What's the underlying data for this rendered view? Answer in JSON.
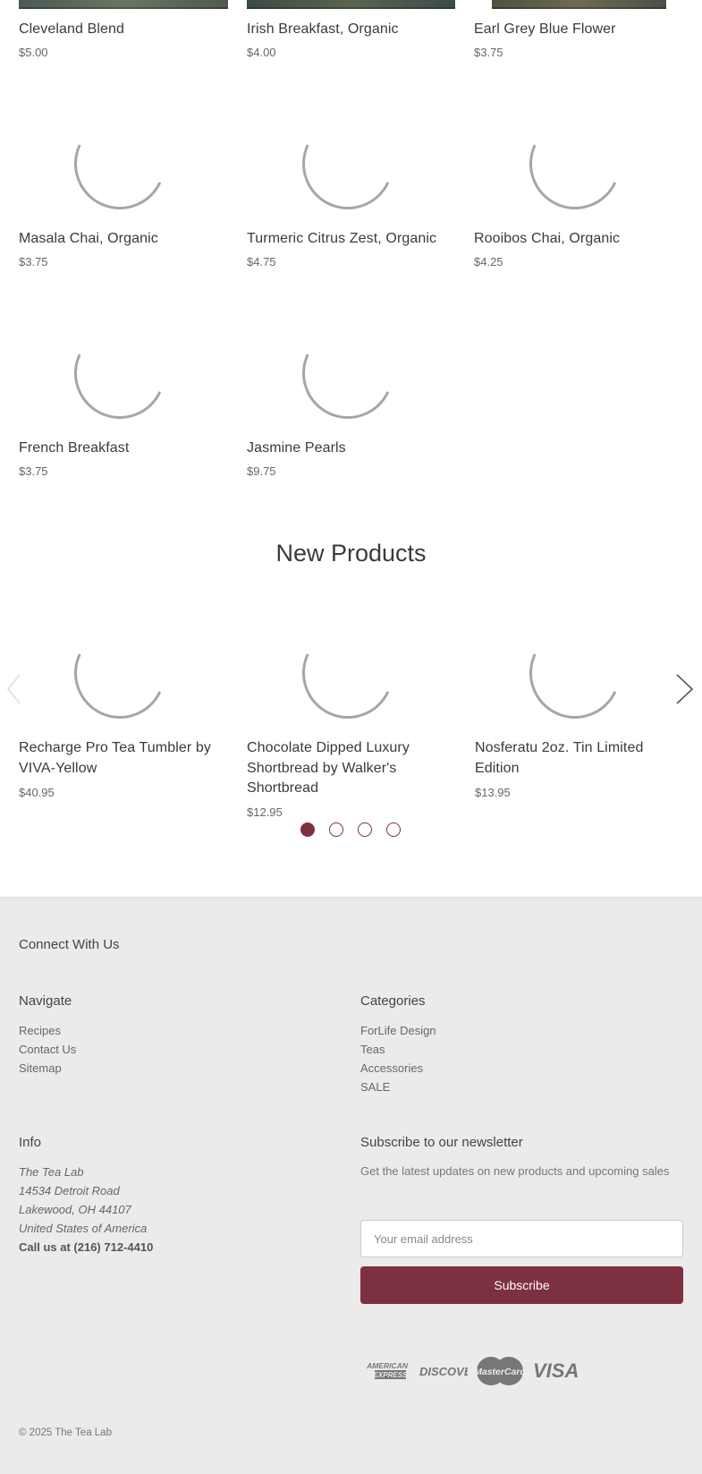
{
  "products_top": [
    {
      "name": "Cleveland Blend",
      "price": "$5.00"
    },
    {
      "name": "Irish Breakfast, Organic",
      "price": "$4.00"
    },
    {
      "name": "Earl Grey Blue Flower",
      "price": "$3.75"
    },
    {
      "name": "Masala Chai, Organic",
      "price": "$3.75"
    },
    {
      "name": "Turmeric Citrus Zest, Organic",
      "price": "$4.75"
    },
    {
      "name": "Rooibos Chai, Organic",
      "price": "$4.25"
    },
    {
      "name": "French Breakfast",
      "price": "$3.75"
    },
    {
      "name": "Jasmine Pearls",
      "price": "$9.75"
    }
  ],
  "new_products": {
    "title": "New Products",
    "items": [
      {
        "name": "Recharge Pro Tea Tumbler by VIVA-Yellow",
        "price": "$40.95"
      },
      {
        "name": "Chocolate Dipped Luxury Shortbread by Walker's Shortbread",
        "price": "$12.95"
      },
      {
        "name": "Nosferatu 2oz. Tin Limited Edition",
        "price": "$13.95"
      }
    ],
    "pagination": {
      "pages": 4,
      "active": 1
    }
  },
  "footer": {
    "connect_title": "Connect With Us",
    "navigate": {
      "title": "Navigate",
      "links": [
        "Recipes",
        "Contact Us",
        "Sitemap"
      ]
    },
    "categories": {
      "title": "Categories",
      "links": [
        "ForLife Design",
        "Teas",
        "Accessories",
        "SALE"
      ]
    },
    "info": {
      "title": "Info",
      "address": [
        "The Tea Lab",
        "14534 Detroit Road",
        "Lakewood, OH 44107",
        "United States of America"
      ],
      "phone": "Call us at (216) 712-4410"
    },
    "newsletter": {
      "title": "Subscribe to our newsletter",
      "description": "Get the latest updates on new products and upcoming sales",
      "email_placeholder": "Your email address",
      "button_label": "Subscribe"
    },
    "payment_icons": [
      "american-express-icon",
      "discover-icon",
      "mastercard-icon",
      "visa-icon"
    ],
    "payment_labels": {
      "amex_line1": "AMERICAN",
      "amex_line2": "EXPRESS",
      "discover": "DISCOVER",
      "mastercard": "MasterCard",
      "visa": "VISA"
    },
    "copyright": "© 2025 The Tea Lab"
  },
  "colors": {
    "accent": "#7d3040",
    "footer_bg": "#ebebeb"
  }
}
